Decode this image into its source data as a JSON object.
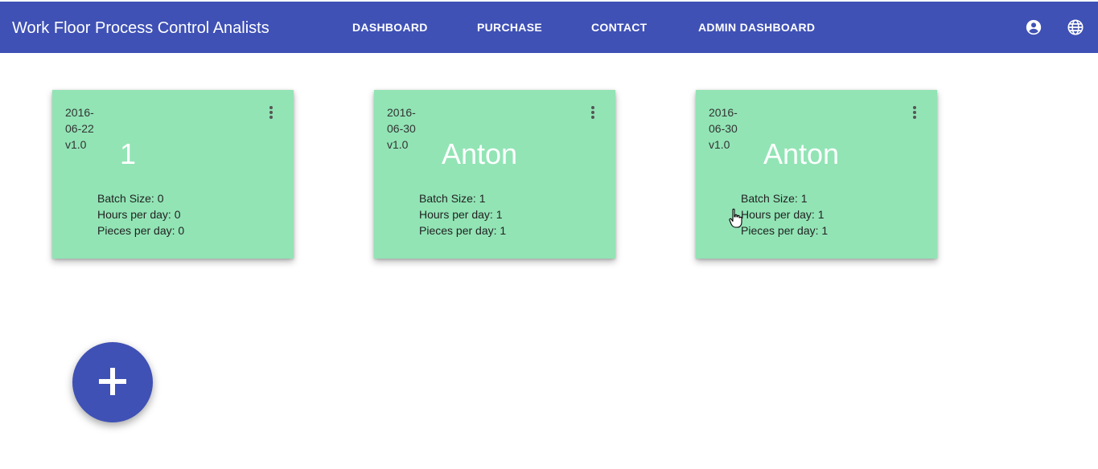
{
  "app": {
    "title": "Work Floor Process Control Analists",
    "brand_color": "#3f51b5"
  },
  "nav": {
    "items": [
      {
        "label": "DASHBOARD"
      },
      {
        "label": "PURCHASE"
      },
      {
        "label": "CONTACT"
      },
      {
        "label": "ADMIN DASHBOARD"
      }
    ],
    "icons": [
      "account-circle-icon",
      "globe-icon"
    ]
  },
  "cards": [
    {
      "date": "2016-06-22",
      "version": "v1.0",
      "name": "1",
      "batch_size": "Batch Size: 0",
      "hours_per_day": "Hours per day: 0",
      "pieces_per_day": "Pieces per day: 0"
    },
    {
      "date": "2016-06-30",
      "version": "v1.0",
      "name": "Anton",
      "batch_size": "Batch Size: 1",
      "hours_per_day": "Hours per day: 1",
      "pieces_per_day": "Pieces per day: 1"
    },
    {
      "date": "2016-06-30",
      "version": "v1.0",
      "name": "Anton",
      "batch_size": "Batch Size: 1",
      "hours_per_day": "Hours per day: 1",
      "pieces_per_day": "Pieces per day: 1"
    }
  ],
  "card_color": "#92e4b5",
  "fab": {
    "icon": "plus-icon"
  }
}
